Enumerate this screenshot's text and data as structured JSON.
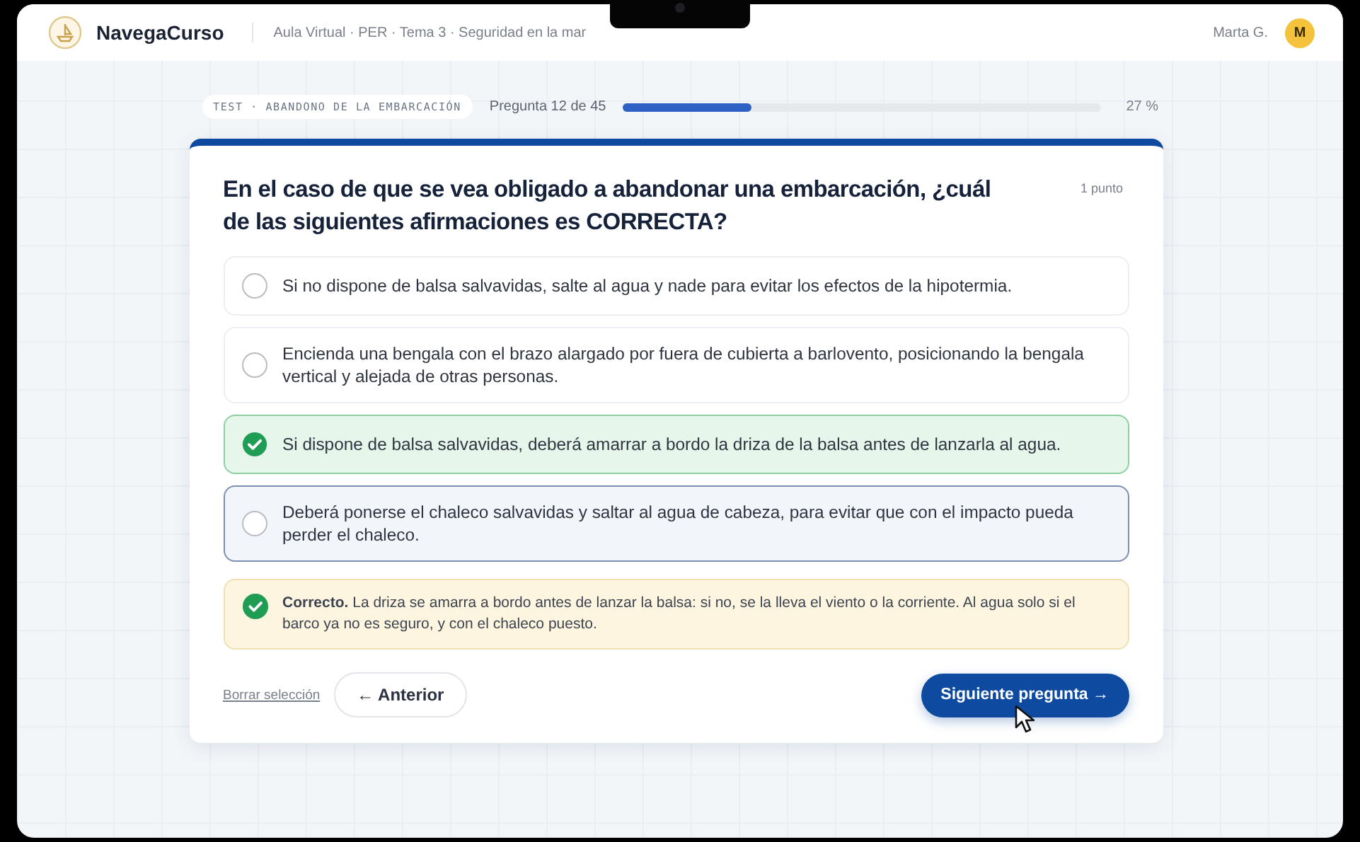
{
  "header": {
    "app_name": "NavegaCurso",
    "breadcrumb": "Aula Virtual · PER · Tema 3 · Seguridad en la mar",
    "user_name": "Marta G.",
    "avatar_initial": "M"
  },
  "progress": {
    "test_label": "TEST · ABANDONO DE LA EMBARCACIÓN",
    "counter": "Pregunta 12 de 45",
    "level": 0.27,
    "percent": "27 %"
  },
  "question": {
    "text": "En el caso de que se vea obligado a abandonar una embarcación, ¿cuál de las siguientes afirmaciones es CORRECTA?",
    "points": "1 punto"
  },
  "options": [
    {
      "text": "Si no dispone de balsa salvavidas, salte al agua y nade para evitar los efectos de la hipotermia.",
      "kind": "default"
    },
    {
      "text": "Encienda una bengala con el brazo alargado por fuera de cubierta a barlovento, posicionando la bengala vertical y alejada de otras personas.",
      "kind": "default"
    },
    {
      "text": "Si dispone de balsa salvavidas, deberá amarrar a bordo la driza de la balsa antes de lanzarla al agua.",
      "kind": "correct"
    },
    {
      "text": "Deberá ponerse el chaleco salvavidas y saltar al agua de cabeza, para evitar que con el impacto pueda perder el chaleco.",
      "kind": "highlighted"
    }
  ],
  "feedback": {
    "text": "**Correcto.** La driza se amarra a bordo antes de lanzar la balsa: si no, se la lleva el viento o la corriente. Al agua solo si el barco ya no es seguro, y con el chaleco puesto."
  },
  "actions": {
    "clear_link": "Borrar selección",
    "previous": "← Anterior",
    "next": "Siguiente pregunta →"
  }
}
